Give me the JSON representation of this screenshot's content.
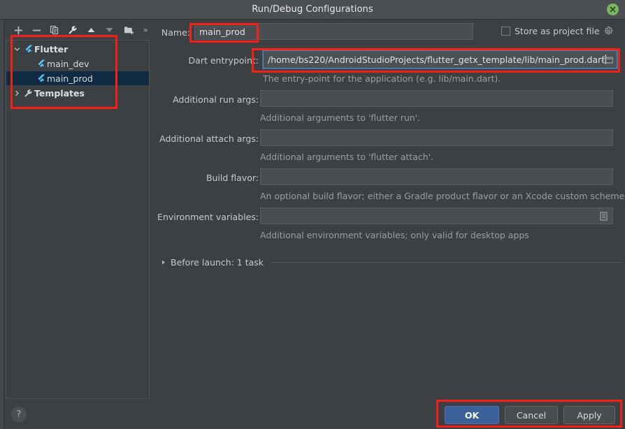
{
  "window": {
    "title": "Run/Debug Configurations",
    "close_icon": "close-icon"
  },
  "toolbar": {
    "icons": [
      {
        "name": "add-icon",
        "title": "Add New Configuration"
      },
      {
        "name": "remove-icon",
        "title": "Remove Configuration"
      },
      {
        "name": "copy-icon",
        "title": "Copy Configuration"
      },
      {
        "name": "edit-templates-icon",
        "title": "Edit Templates"
      },
      {
        "name": "move-up-icon",
        "title": "Move Up"
      },
      {
        "name": "move-down-icon",
        "title": "Move Down"
      },
      {
        "name": "new-folder-icon",
        "title": "New Folder"
      },
      {
        "name": "overflow-chevron-icon",
        "title": "More"
      }
    ]
  },
  "tree": {
    "items": [
      {
        "label": "Flutter",
        "icon": "flutter-icon",
        "expander": "chevron-down-icon",
        "depth": 0,
        "bold": true,
        "selected": false
      },
      {
        "label": "main_dev",
        "icon": "flutter-icon",
        "expander": "",
        "depth": 1,
        "bold": false,
        "selected": false
      },
      {
        "label": "main_prod",
        "icon": "flutter-icon",
        "expander": "",
        "depth": 1,
        "bold": false,
        "selected": true
      },
      {
        "label": "Templates",
        "icon": "wrench-icon",
        "expander": "chevron-right-icon",
        "depth": 0,
        "bold": true,
        "selected": false
      }
    ]
  },
  "help": {
    "label": "?"
  },
  "form": {
    "name_label": "Name:",
    "name_value": "main_prod",
    "store_as_project_file_label": "Store as project file",
    "store_as_project_file_checked": false,
    "store_gear_icon": "gear-icon",
    "dart_entrypoint_label": "Dart entrypoint:",
    "dart_entrypoint_value": "/home/bs220/AndroidStudioProjects/flutter_getx_template/lib/main_prod.dart",
    "dart_entrypoint_browse_icon": "folder-browse-icon",
    "dart_entrypoint_hint": "The entry-point for the application (e.g. lib/main.dart).",
    "additional_run_args_label": "Additional run args:",
    "additional_run_args_value": "",
    "additional_run_args_hint": "Additional arguments to 'flutter run'.",
    "additional_attach_args_label": "Additional attach args:",
    "additional_attach_args_value": "",
    "additional_attach_args_hint": "Additional arguments to 'flutter attach'.",
    "build_flavor_label": "Build flavor:",
    "build_flavor_value": "",
    "build_flavor_hint": "An optional build flavor; either a Gradle product flavor or an Xcode custom scheme.",
    "environment_variables_label": "Environment variables:",
    "environment_variables_value": "",
    "environment_variables_browse_icon": "list-edit-icon",
    "environment_variables_hint": "Additional environment variables; only valid for desktop apps",
    "before_launch_label": "Before launch: 1 task",
    "before_launch_expander": "chevron-right-icon"
  },
  "buttons": {
    "ok": "OK",
    "cancel": "Cancel",
    "apply": "Apply"
  },
  "colors": {
    "background": "#3c4043",
    "titlebar": "#4a4f52",
    "selection": "#112b42",
    "accent_blue": "#3c6099",
    "flutter_blue": "#45b4e8",
    "annotation_red": "#f41f16",
    "close_green": "#7bb661"
  }
}
